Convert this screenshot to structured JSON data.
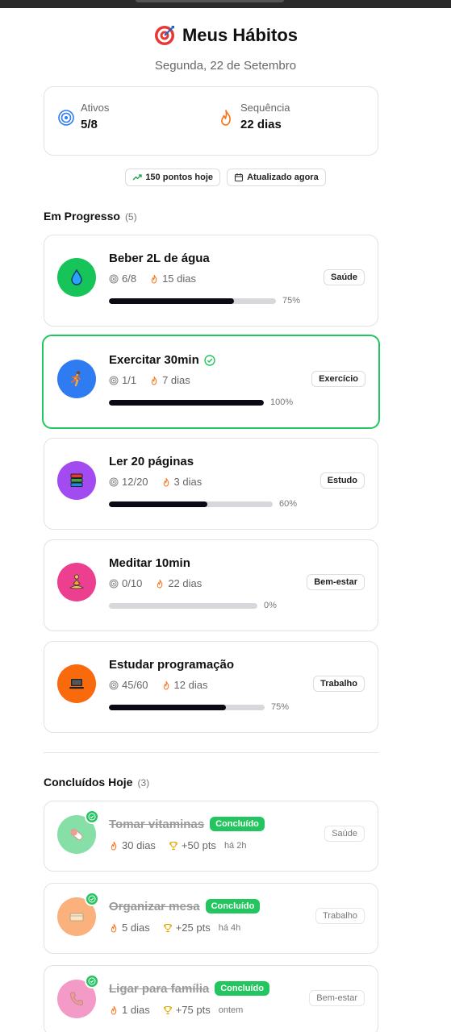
{
  "header": {
    "title": "Meus Hábitos",
    "date": "Segunda, 22 de Setembro"
  },
  "stats": {
    "active": {
      "label": "Ativos",
      "value": "5/8"
    },
    "streak": {
      "label": "Sequência",
      "value": "22 dias"
    }
  },
  "chips": {
    "points": "150 pontos hoje",
    "updated": "Atualizado agora"
  },
  "in_progress": {
    "title": "Em Progresso",
    "count": "(5)",
    "habits": [
      {
        "name": "Beber 2L de água",
        "progress": "6/8",
        "streak": "15 dias",
        "percent_label": "75%",
        "percent": 75,
        "tag": "Saúde",
        "color": "#16c45a",
        "icon": "water-drop-icon",
        "completed": false
      },
      {
        "name": "Exercitar 30min",
        "progress": "1/1",
        "streak": "7 dias",
        "percent_label": "100%",
        "percent": 100,
        "tag": "Exercício",
        "color": "#2f7bf2",
        "icon": "running-icon",
        "completed": true
      },
      {
        "name": "Ler 20 páginas",
        "progress": "12/20",
        "streak": "3 dias",
        "percent_label": "60%",
        "percent": 60,
        "tag": "Estudo",
        "color": "#a24bf0",
        "icon": "books-icon",
        "completed": false
      },
      {
        "name": "Meditar 10min",
        "progress": "0/10",
        "streak": "22 dias",
        "percent_label": "0%",
        "percent": 0,
        "tag": "Bem-estar",
        "color": "#ec3f8f",
        "icon": "meditation-icon",
        "completed": false
      },
      {
        "name": "Estudar programação",
        "progress": "45/60",
        "streak": "12 dias",
        "percent_label": "75%",
        "percent": 75,
        "tag": "Trabalho",
        "color": "#f96a0c",
        "icon": "laptop-icon",
        "completed": false
      }
    ]
  },
  "done_today": {
    "title": "Concluídos Hoje",
    "count": "(3)",
    "badge": "Concluído",
    "habits": [
      {
        "name": "Tomar vitaminas",
        "streak": "30 dias",
        "points": "+50 pts",
        "ago": "há 2h",
        "tag": "Saúde",
        "color": "#22c55e",
        "icon": "pill-icon"
      },
      {
        "name": "Organizar mesa",
        "streak": "5 dias",
        "points": "+25 pts",
        "ago": "há 4h",
        "tag": "Trabalho",
        "color": "#f97316",
        "icon": "desk-icon"
      },
      {
        "name": "Ligar para família",
        "streak": "1 dias",
        "points": "+75 pts",
        "ago": "ontem",
        "tag": "Bem-estar",
        "color": "#ec4899",
        "icon": "phone-icon"
      }
    ]
  }
}
